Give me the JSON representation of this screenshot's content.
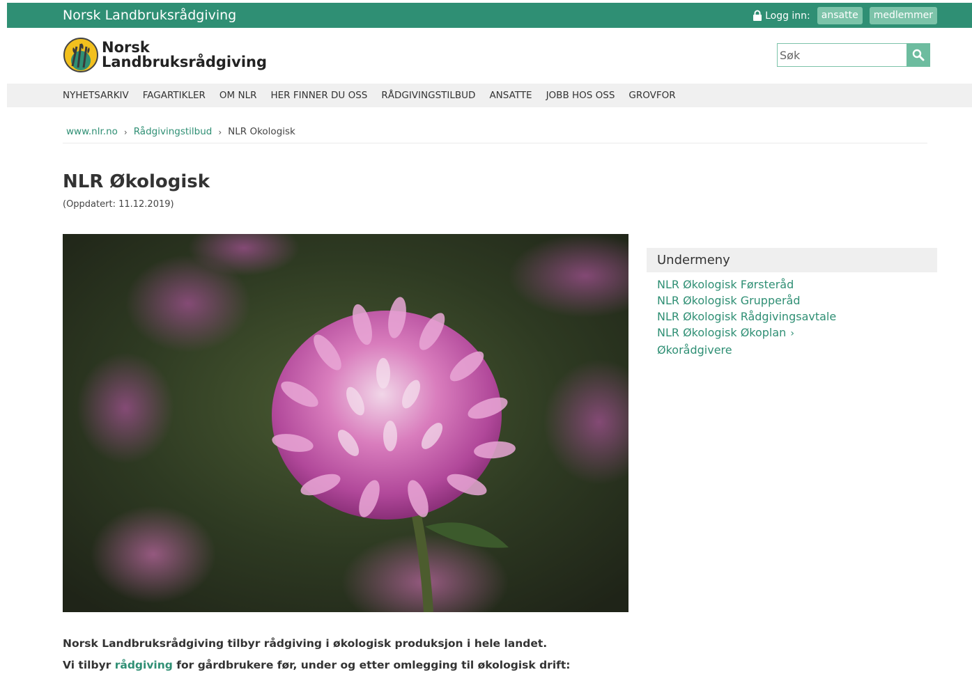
{
  "topbar": {
    "site_name": "Norsk Landbruksrådgiving",
    "login_label": "Logg inn:",
    "login_staff": "ansatte",
    "login_members": "medlemmer"
  },
  "header": {
    "logo_line1": "Norsk",
    "logo_line2": "Landbruksrådgiving",
    "search_placeholder": "Søk"
  },
  "nav": {
    "items": [
      "NYHETSARKIV",
      "FAGARTIKLER",
      "OM NLR",
      "HER FINNER DU OSS",
      "RÅDGIVINGSTILBUD",
      "ANSATTE",
      "JOBB HOS OSS",
      "GROVFOR"
    ]
  },
  "breadcrumb": {
    "home": "www.nlr.no",
    "parent": "Rådgivingstilbud",
    "current": "NLR Okologisk"
  },
  "page": {
    "title": "NLR Økologisk",
    "updated": "(Oppdatert: 11.12.2019)"
  },
  "submenu": {
    "heading": "Undermeny",
    "items": [
      "NLR Økologisk Førsteråd",
      "NLR Økologisk Grupperåd",
      "NLR Økologisk Rådgivingsavtale",
      "NLR Økologisk Økoplan",
      "Økorådgivere"
    ]
  },
  "body": {
    "para1": "Norsk Landbruksrådgiving tilbyr rådgiving i økologisk produksjon i hele landet.",
    "para2_prefix": "Vi tilbyr ",
    "para2_link": "rådgiving",
    "para2_suffix": " for gårdbrukere før, under og etter omlegging til økologisk drift:"
  },
  "colors": {
    "brand_green": "#2f8f74",
    "light_green": "#7cc3a9"
  }
}
